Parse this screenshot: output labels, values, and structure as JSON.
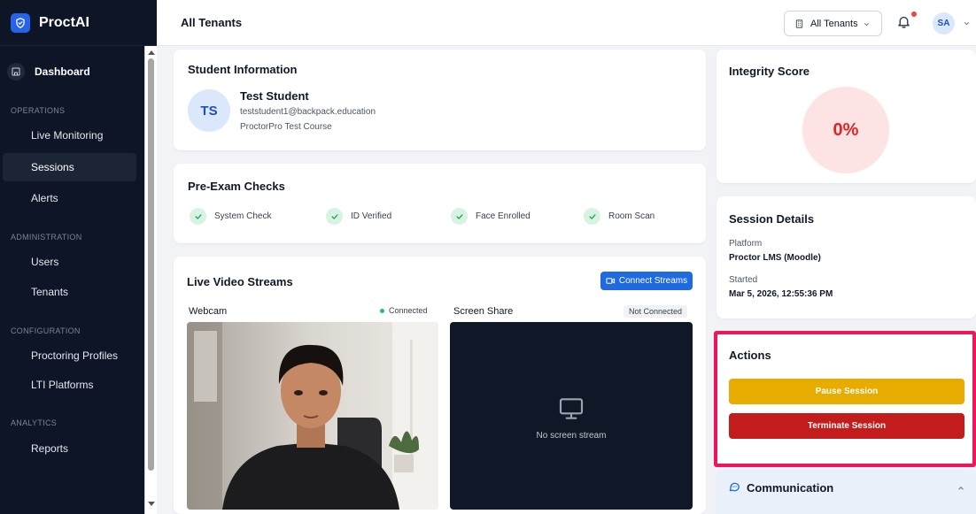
{
  "app": {
    "name": "ProctAI"
  },
  "sidebar": {
    "dashboard": "Dashboard",
    "sections": [
      {
        "label": "OPERATIONS",
        "items": [
          "Live Monitoring",
          "Sessions",
          "Alerts"
        ]
      },
      {
        "label": "ADMINISTRATION",
        "items": [
          "Users",
          "Tenants"
        ]
      },
      {
        "label": "CONFIGURATION",
        "items": [
          "Proctoring Profiles",
          "LTI Platforms"
        ]
      },
      {
        "label": "ANALYTICS",
        "items": [
          "Reports"
        ]
      }
    ],
    "active_item": "Sessions"
  },
  "header": {
    "title": "All Tenants",
    "tenant_select": "All Tenants",
    "avatar": "SA",
    "notifications_unread": true
  },
  "student": {
    "section_title": "Student Information",
    "initials": "TS",
    "name": "Test Student",
    "email": "teststudent1@backpack.education",
    "course": "ProctorPro Test Course"
  },
  "prechecks": {
    "title": "Pre-Exam Checks",
    "items": [
      "System Check",
      "ID Verified",
      "Face Enrolled",
      "Room Scan"
    ]
  },
  "streams": {
    "title": "Live Video Streams",
    "connect_button": "Connect Streams",
    "webcam_label": "Webcam",
    "webcam_status": "Connected",
    "screen_label": "Screen Share",
    "screen_status": "Not Connected",
    "screen_empty": "No screen stream"
  },
  "integrity": {
    "title": "Integrity Score",
    "score": "0%"
  },
  "session": {
    "title": "Session Details",
    "platform_label": "Platform",
    "platform": "Proctor LMS (Moodle)",
    "started_label": "Started",
    "started": "Mar 5, 2026, 12:55:36 PM"
  },
  "actions": {
    "title": "Actions",
    "pause": "Pause Session",
    "terminate": "Terminate Session"
  },
  "communication": {
    "title": "Communication"
  },
  "colors": {
    "sidebar_bg": "#0d1526",
    "primary": "#1f6ae0",
    "pause": "#e8ac00",
    "terminate": "#c31c1c",
    "highlight": "#f0145a",
    "success": "#22c55e",
    "danger_text": "#dc2626"
  }
}
